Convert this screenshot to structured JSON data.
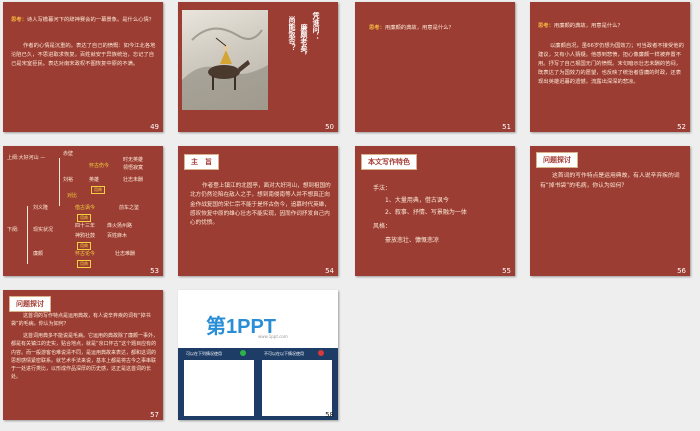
{
  "slides": {
    "s49": {
      "num": "49",
      "think": "思考：",
      "q": "诗人写檐暮河下的辞神赛会的一幕景象。是什么心情？",
      "body": "作者的心情是沉重的。表达了自己的愤慨：如今江北各地沦陷已久，不思进取求恢复。百姓就安于异族统治，忘记了自己是宋室臣民。表达对南宋政权不图恢复中原的不满。"
    },
    "s50": {
      "num": "50",
      "vert1": "凭谁问：",
      "vert2": "廉颇老矣，",
      "vert3": "尚能饭否？"
    },
    "s51": {
      "num": "51",
      "think": "思考：",
      "q": "用廉颇的典故，用意是什么？"
    },
    "s52": {
      "num": "52",
      "think": "思考：",
      "q": "用廉颇的典故，用意是什么？",
      "body": "以廉颇自况，虽66岁仍想为国效力；可当政者不接受他的建议，又有小人猜疑。他感到悲愤，担心像廉颇一样被弃置不用。抒写了自己报国无门的愤慨。末句暗示壮志未酬的苦闷，既表达了为国效力的愿望，也反映了统治者昏庸的时政，还表现出英雄迟暮的遗憾，流露出深深的悲凉。"
    },
    "s53": {
      "num": "53",
      "root": "上阕:大好河山 —",
      "root2": "下阕:",
      "items": [
        {
          "a": "赤壁",
          "b": "",
          "c": ""
        },
        {
          "a": "怀古伤今",
          "b": "时无英雄",
          "c": "领悟寂寞"
        },
        {
          "a": "刘裕",
          "b": "英雄",
          "c": "壮志未酬"
        },
        {
          "a": "对比",
          "b": "",
          "c": ""
        },
        {
          "a": "刘义隆",
          "b": "借古讽今",
          "c": "前车之鉴"
        },
        {
          "a": "现实状况",
          "b": "四十三年",
          "c": "烽火扬州路"
        },
        {
          "a": "神鸦社鼓",
          "b": "百姓麻木",
          "c": ""
        },
        {
          "a": "廉颇",
          "b": "用典",
          "c": "怀古论今"
        }
      ],
      "tag1": "用典",
      "tag2": "用典",
      "tag3": "用典",
      "tag4": "用典",
      "tag5": "用典",
      "last": "壮志难酬"
    },
    "s54": {
      "num": "54",
      "title": "主　旨",
      "body": "作者登上镇江的北固亭，面对大好河山，想到祖国的北方仍然沦陷在敌人之手，想到南侵南等人并不想真正向金作战复国的宋仁宗不能于是怀古伤今，追慕时代英雄，感叹恢复中原的雄心壮志不能实现，因而作词抒发自己内心的忧愤。"
    },
    "s55": {
      "num": "55",
      "title": "本文写作特色",
      "h1": "手法：",
      "l1": "1、大量用典，借古讽今",
      "l2": "2、叙事、抒情、写景融为一体",
      "h2": "风格：",
      "l3": "豪放悲壮、慷慨悲凉"
    },
    "s56": {
      "num": "56",
      "title": "问题探讨",
      "body": "这首词的写作特点是运用典故，有人说辛弃疾的词有“掉书袋”的毛病，你认为如何？"
    },
    "s57": {
      "num": "57",
      "title": "问题探讨",
      "q": "这首词的写作特点是运用典故，有人说辛弃疾的词有“掉书袋”的毛病，你认为如何？",
      "a1": "这首词用典多不能说是毛病。它运用的典故除了廉颇一事外，都是有关镇江的史实，贴合地点，就是“京口怀古”这个题目应有的内容。而一般游客也难说清不同，是运用典故来表达，都和这词的思想感情紧密联系。就艺术手法来说，基本上都是将古今之事串联于一处进行类比，以形成作品深厚的历史感，这正是这首词的长处。"
    },
    "s58": {
      "num": "58",
      "logo": "第1PPT",
      "site": "www.1ppt.com",
      "caption1": "可以在下列情况使用",
      "caption2": "不可以在以下情况使用"
    }
  },
  "colors": {
    "slide_bg": "#9c3d34",
    "think": "#f4b23d",
    "highlight": "#f4d23d",
    "text": "#fbe9d4"
  }
}
